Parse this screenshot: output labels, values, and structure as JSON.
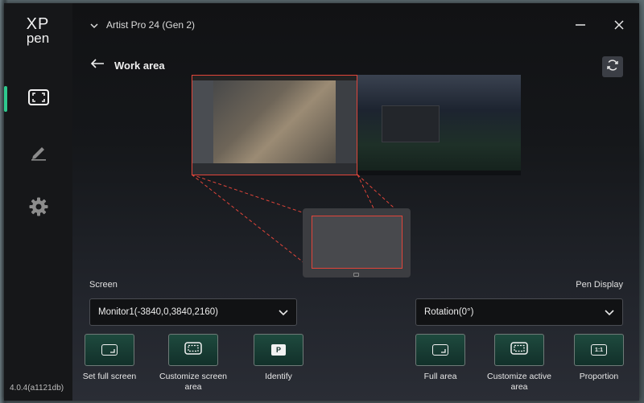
{
  "app": {
    "logo_line1": "XP",
    "logo_line2": "pen",
    "version": "4.0.4(a1121db)",
    "device_name": "Artist Pro 24 (Gen 2)",
    "accent_color": "#2ec98e",
    "highlight_color": "#e2453a"
  },
  "sidebar": {
    "items": [
      {
        "icon": "work-area-icon",
        "active": true
      },
      {
        "icon": "pen-icon",
        "active": false
      },
      {
        "icon": "settings-gear-icon",
        "active": false
      }
    ]
  },
  "page": {
    "title": "Work area",
    "back_icon": "back-arrow-icon",
    "refresh_icon": "refresh-icon"
  },
  "screen_section": {
    "label": "Screen",
    "dropdown_value": "Monitor1(-3840,0,3840,2160)",
    "actions": [
      {
        "label": "Set full screen",
        "icon": "full-screen-icon"
      },
      {
        "label": "Customize screen area",
        "icon": "custom-area-icon"
      },
      {
        "label": "Identify",
        "icon": "identify-icon",
        "icon_text": "P"
      }
    ]
  },
  "pen_display_section": {
    "label": "Pen Display",
    "dropdown_value": "Rotation(0°)",
    "actions": [
      {
        "label": "Full area",
        "icon": "full-area-icon"
      },
      {
        "label": "Customize active area",
        "icon": "custom-active-area-icon"
      },
      {
        "label": "Proportion",
        "icon": "proportion-icon",
        "icon_text": "1:1"
      }
    ]
  }
}
